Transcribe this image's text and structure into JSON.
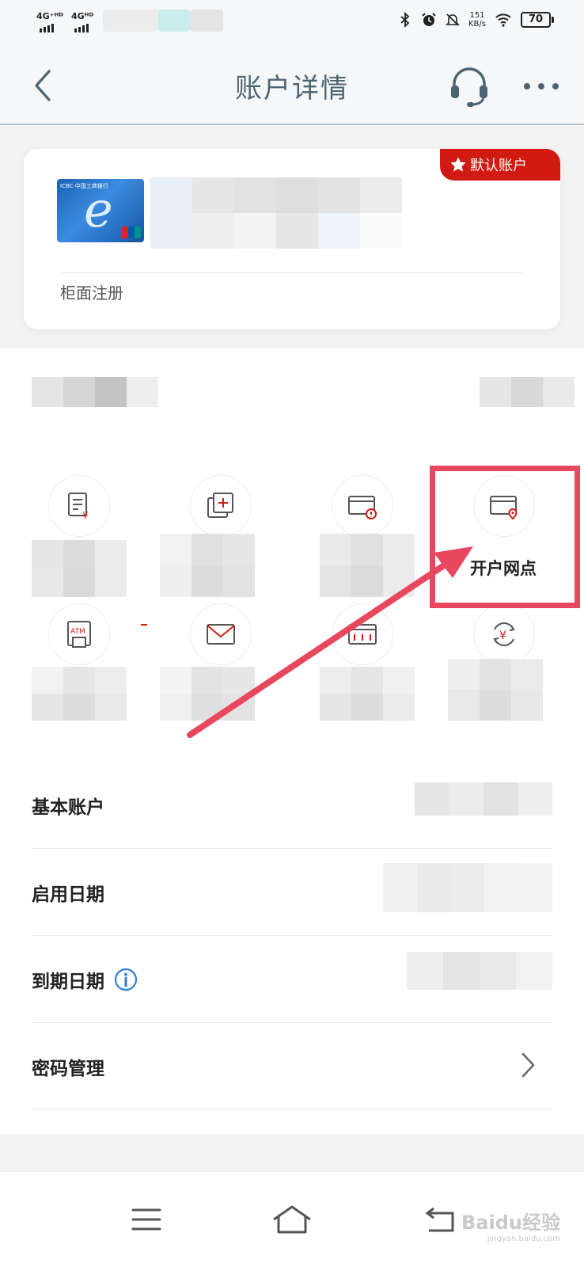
{
  "status_bar": {
    "network_1": "4G⁺ᴴᴰ",
    "network_2": "4Gᴴᴰ",
    "net_speed_value": "151",
    "net_speed_unit": "KB/s",
    "battery": "70",
    "icons": [
      "bluetooth-icon",
      "alarm-icon",
      "mute-icon",
      "wifi-icon"
    ]
  },
  "header": {
    "title": "账户详情",
    "icons": [
      "back-icon",
      "headset-icon",
      "more-icon"
    ]
  },
  "account_card": {
    "default_badge": "默认账户",
    "card_brand": "ICBC 中国工商银行",
    "registration": "柜面注册"
  },
  "functions": [
    {
      "icon": "statement-icon",
      "label": ""
    },
    {
      "icon": "add-card-icon",
      "label": ""
    },
    {
      "icon": "card-alert-icon",
      "label": ""
    },
    {
      "icon": "card-location-icon",
      "label": "开户网点"
    },
    {
      "icon": "atm-icon",
      "label": ""
    },
    {
      "icon": "mail-icon",
      "label": ""
    },
    {
      "icon": "card-limit-icon",
      "label": ""
    },
    {
      "icon": "currency-exchange-icon",
      "label": ""
    }
  ],
  "details": {
    "basic_account": "基本账户",
    "start_date": "启用日期",
    "expiry_date": "到期日期",
    "password": "密码管理"
  },
  "navbar": {
    "icons": [
      "menu-icon",
      "home-icon",
      "back-nav-icon"
    ]
  },
  "watermark": {
    "text": "Baidu经验",
    "sub": "jingyan.baidu.com"
  },
  "colors": {
    "accent_red": "#d11a12",
    "annotation": "#e8485f",
    "title_blue": "#4c6472",
    "info_blue": "#2f7fd1"
  }
}
